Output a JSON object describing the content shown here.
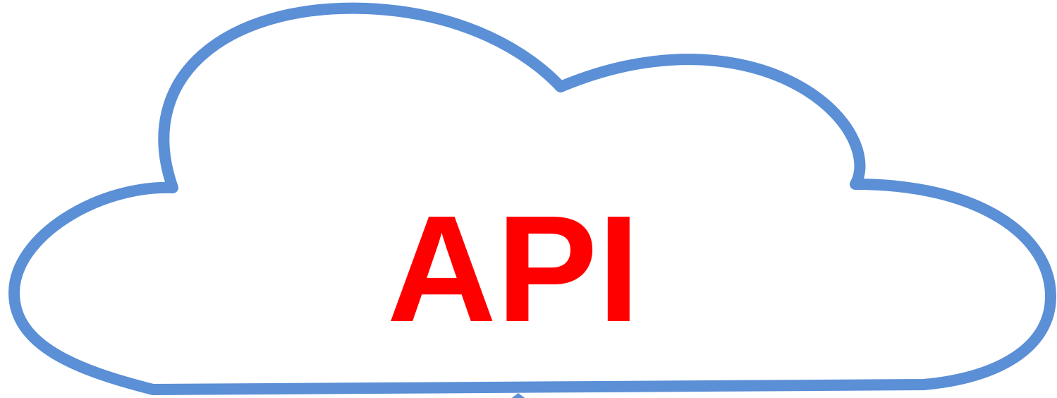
{
  "diagram": {
    "label": "API",
    "label_color": "#ff0000",
    "outline_color": "#5b8fd6",
    "fill_color": "#ffffff",
    "shape": "cloud",
    "connector": "arrow-up"
  }
}
